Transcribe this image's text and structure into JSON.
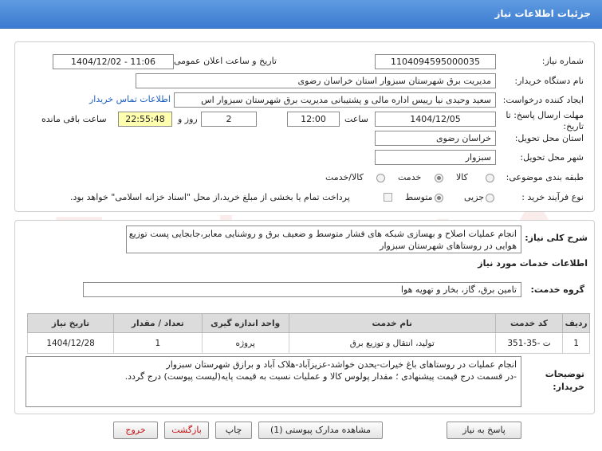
{
  "header": {
    "title": "جزئیات اطلاعات نیاز"
  },
  "watermark": {
    "text": "AriaTender.net"
  },
  "form": {
    "need_number_label": "شماره نیاز:",
    "need_number": "1104094595000035",
    "announce_label": "تاریخ و ساعت اعلان عمومی:",
    "announce_value": "1404/12/02 - 11:06",
    "buyer_org_label": "نام دستگاه خریدار:",
    "buyer_org": "مدیریت برق شهرستان سبزوار استان خراسان رضوی",
    "creator_label": "ایجاد کننده درخواست:",
    "creator": "سعید وحیدی نیا رییس اداره مالی و پشتیبانی مدیریت برق شهرستان سبزوار اس",
    "contact_link": "اطلاعات تماس خریدار",
    "deadline_label": "مهلت ارسال پاسخ: تا تاریخ:",
    "deadline_date": "1404/12/05",
    "time_label": "ساعت",
    "deadline_time": "12:00",
    "days_value": "2",
    "days_label": "روز و",
    "remaining_time": "22:55:48",
    "remaining_label": "ساعت باقی مانده",
    "province_label": "استان محل تحویل:",
    "province": "خراسان رضوی",
    "city_label": "شهر محل تحویل:",
    "city": "سبزوار",
    "category_label": "طبقه بندی موضوعی:",
    "category_options": [
      "کالا",
      "خدمت",
      "کالا/خدمت"
    ],
    "category_selected": "خدمت",
    "process_label": "نوع فرآیند خرید :",
    "process_options": [
      "جزیی",
      "متوسط"
    ],
    "process_selected": "متوسط",
    "payment_note": "پرداخت تمام یا بخشی از مبلغ خرید،از محل \"اسناد خزانه اسلامی\" خواهد بود."
  },
  "details": {
    "summary_label": "شرح کلی نیاز:",
    "summary_line1": "انجام عملیات اصلاح و بهسازی شبکه های فشار متوسط و ضعیف برق و روشنایی معابر،جابجایی پست توزیع",
    "summary_line2": "هوایی در روستاهای شهرستان سبزوار",
    "services_heading": "اطلاعات خدمات مورد نیاز",
    "service_group_label": "گروه خدمت:",
    "service_group": "تامین برق، گاز، بخار و تهویه هوا",
    "table": {
      "headers": [
        "ردیف",
        "کد خدمت",
        "نام خدمت",
        "واحد اندازه گیری",
        "تعداد / مقدار",
        "تاریخ نیاز"
      ],
      "rows": [
        [
          "1",
          "ت -35-351",
          "تولید، انتقال و توزیع برق",
          "پروژه",
          "1",
          "1404/12/28"
        ]
      ]
    },
    "buyer_notes_label": "توضیحات خریدار:",
    "buyer_notes_line1": "انجام عملیات در روستاهای باغ خیرات-یحدن خواشد-عزیزآباد-هلاک آباد و برازق شهرستان سبزوار",
    "buyer_notes_line2": "-در قسمت درج قیمت پیشنهادی ؛ مقدار پولوس کالا و عملیات نسبت به قیمت پایه(لیست پیوست) درج گردد."
  },
  "buttons": {
    "reply": "پاسخ به نیاز",
    "view_docs": "مشاهده مدارک پیوستی (1)",
    "print": "چاپ",
    "back": "بازگشت",
    "exit": "خروج"
  },
  "colors": {
    "accent": "#3b7bd1",
    "remaining_bg": "#ffffb0",
    "link": "#1b5fc1",
    "danger": "#c21010"
  }
}
